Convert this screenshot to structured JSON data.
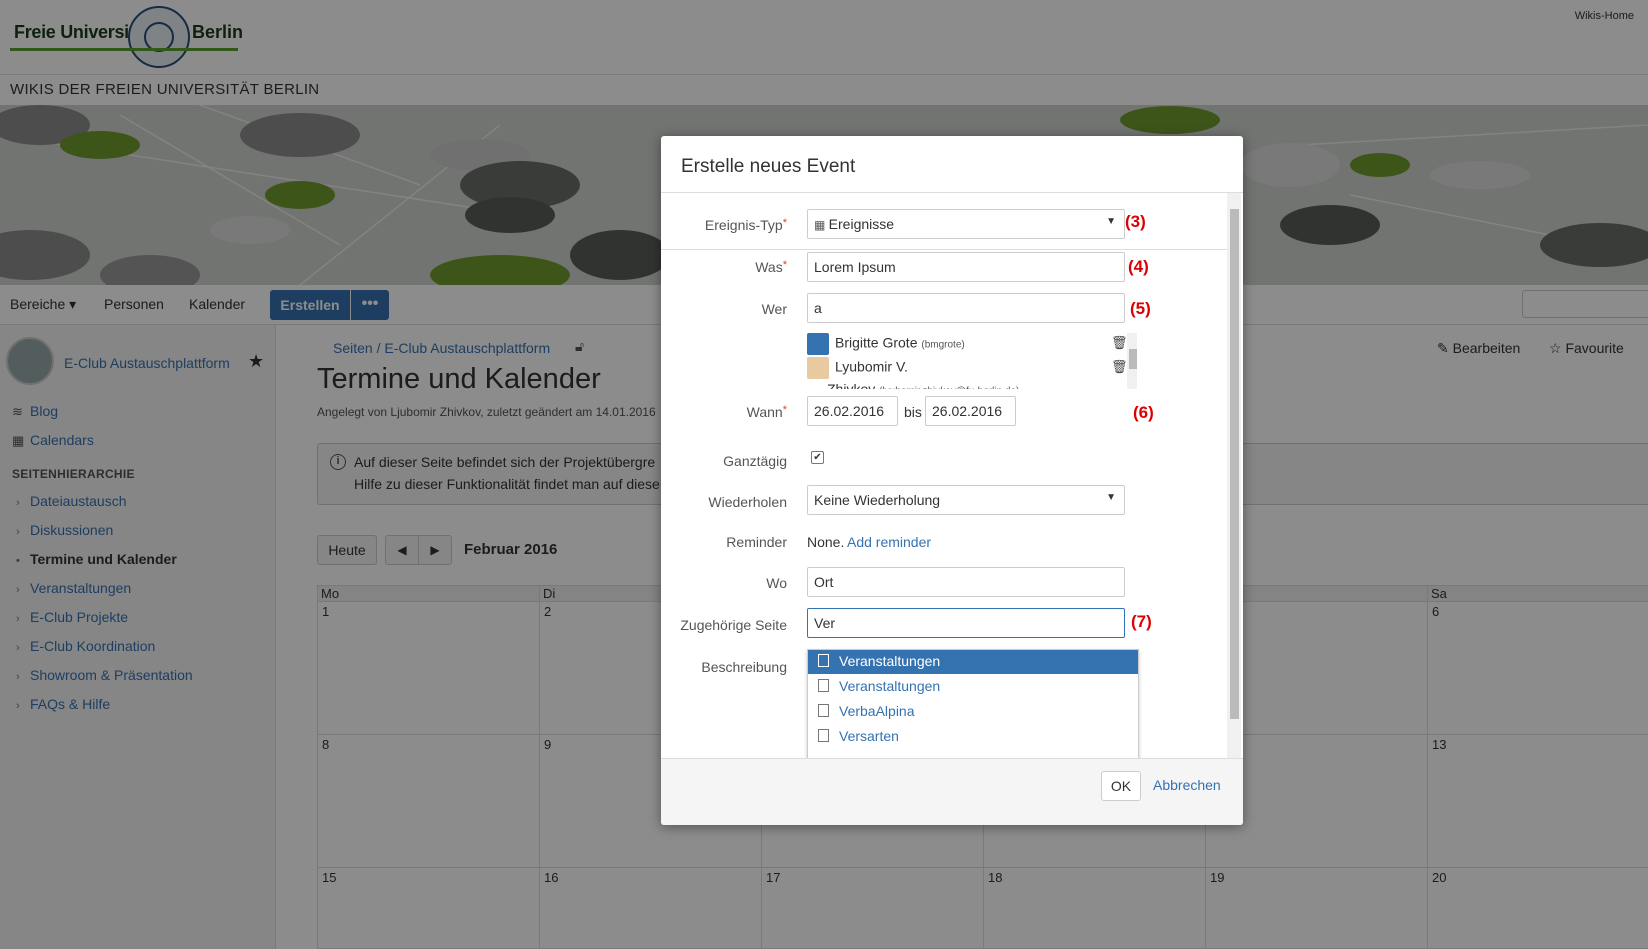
{
  "header": {
    "logo_left": "Freie Universität",
    "logo_right": "Berlin",
    "wikis_home": "Wikis-Home",
    "subtitle": "WIKIS DER FREIEN UNIVERSITÄT BERLIN"
  },
  "nav": {
    "bereiche": "Bereiche ▾",
    "personen": "Personen",
    "kalender": "Kalender",
    "erstellen": "Erstellen",
    "more": "•••"
  },
  "sidebar": {
    "space_name": "E-Club Austauschplattform",
    "blog": "Blog",
    "calendars": "Calendars",
    "hierarchy_title": "SEITENHIERARCHIE",
    "tree": [
      {
        "label": "Dateiaustausch"
      },
      {
        "label": "Diskussionen"
      },
      {
        "label": "Termine und Kalender"
      },
      {
        "label": "Veranstaltungen"
      },
      {
        "label": "E-Club Projekte"
      },
      {
        "label": "E-Club Koordination"
      },
      {
        "label": "Showroom & Präsentation"
      },
      {
        "label": "FAQs & Hilfe"
      }
    ]
  },
  "main": {
    "breadcrumb": "Seiten  /  E-Club Austauschplattform",
    "edit": "Bearbeiten",
    "favourite": "Favourite",
    "title": "Termine und Kalender",
    "meta": "Angelegt von Ljubomir Zhivkov, zuletzt geändert am 14.01.2016",
    "info_line1": "Auf dieser Seite befindet sich der Projektübergre",
    "info_line2": "Hilfe zu dieser Funktionalität findet man auf diese",
    "calendar": {
      "today": "Heute",
      "prev": "◀",
      "next": "▶",
      "month": "Februar 2016",
      "headers": [
        "Mo",
        "Di",
        "",
        "",
        "",
        "",
        "Sa"
      ],
      "rows": [
        [
          "1",
          "2",
          "",
          "",
          "",
          "",
          "6"
        ],
        [
          "8",
          "9",
          "",
          "",
          "",
          "",
          "13"
        ],
        [
          "15",
          "16",
          "17",
          "18",
          "19",
          "",
          "20"
        ]
      ]
    }
  },
  "dialog": {
    "title": "Erstelle neues Event",
    "labels": {
      "typ": "Ereignis-Typ",
      "was": "Was",
      "wer": "Wer",
      "wann": "Wann",
      "ganztaegig": "Ganztägig",
      "wiederholen": "Wiederholen",
      "reminder": "Reminder",
      "wo": "Wo",
      "seite": "Zugehörige Seite",
      "beschreibung": "Beschreibung"
    },
    "required_mark": "*",
    "typ_value": "Ereignisse",
    "was_value": "Lorem Ipsum",
    "wer_value": "a",
    "users": [
      {
        "name": "Brigitte Grote",
        "id": "(bmgrote)"
      },
      {
        "name": "Lyubomir V.",
        "name2": "Zhivkov",
        "id": "(lyubomir.zhivkov@fu-berlin.de)"
      }
    ],
    "wann_from": "26.02.2016",
    "bis": "bis",
    "wann_to": "26.02.2016",
    "wiederholen_value": "Keine Wiederholung",
    "reminder_none": "None.",
    "reminder_add": "Add reminder",
    "wo_value": "Ort",
    "seite_value": "Ver",
    "suggestions": [
      "Veranstaltungen",
      "Veranstaltungen",
      "VerbaAlpina",
      "Versarten"
    ],
    "ok": "OK",
    "cancel": "Abbrechen",
    "annotations": [
      "(3)",
      "(4)",
      "(5)",
      "(6)",
      "(7)"
    ]
  },
  "colors": {
    "brand_green": "#5aa02c",
    "link_blue": "#3572b0",
    "annotation_red": "#dd0000"
  }
}
